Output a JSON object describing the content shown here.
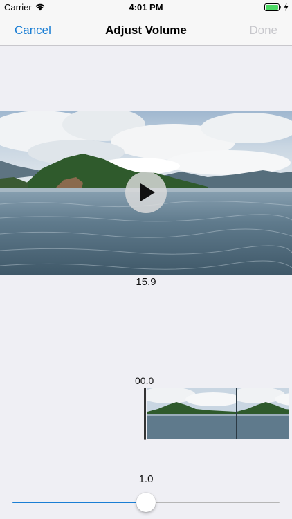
{
  "status_bar": {
    "carrier": "Carrier",
    "time": "4:01 PM",
    "wifi_icon": "wifi-icon",
    "battery_icon": "battery-full-icon",
    "charging_icon": "charging-bolt-icon",
    "battery_color": "#4cd964"
  },
  "nav_bar": {
    "cancel_label": "Cancel",
    "title": "Adjust Volume",
    "done_label": "Done",
    "accent_color": "#1a7ed4",
    "disabled_color": "#c7c7cc"
  },
  "video": {
    "play_icon": "play-icon",
    "duration": "15.9"
  },
  "timeline": {
    "current_time": "00.0"
  },
  "volume": {
    "value_label": "1.0",
    "slider_fraction": 0.5
  }
}
